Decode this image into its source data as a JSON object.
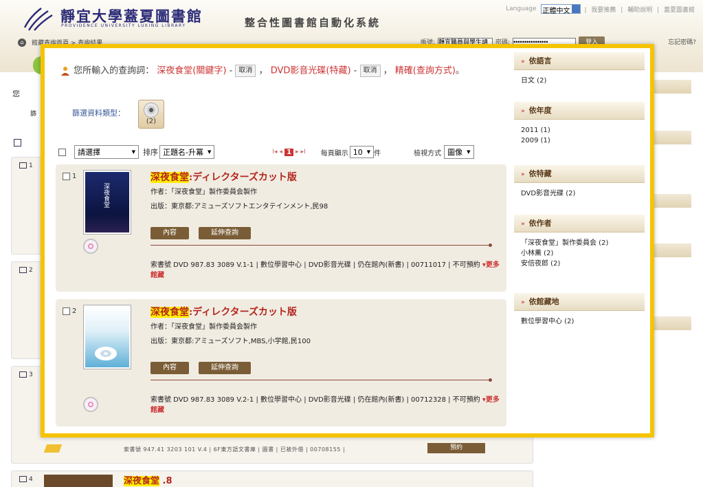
{
  "header": {
    "library_name": "靜宜大學蓋夏圖書館",
    "library_name_en": "PROVIDENCE UNIVERSITY LUKING LIBRARY",
    "system_title": "整合性圖書館自動化系統",
    "language_label": "Language",
    "language_value": "正體中文",
    "top_links": [
      "我要推薦",
      "輔助說明",
      "蓋夏圖書館"
    ],
    "breadcrumb": "館藏查詢首頁 > 查詢結果",
    "account_label": "帳號:",
    "account_placeholder": "靜宜職員與學生請",
    "password_label": "密碼:",
    "password_value": "••••••••••••••••",
    "login_button": "登入",
    "forgot_link": "忘記密碼?"
  },
  "background": {
    "left_text": "您",
    "left_text2": "篩",
    "rows": [
      "1",
      "2",
      "3",
      "4"
    ],
    "bottom_callno": "索書號 947.41 3203 101 V.4 | 6F東方語文書庫 | 圖書 | 已被外借 | 00708155 |",
    "bottom_button": "預約",
    "item4_title_hl": "深夜食堂",
    "item4_title_rest": " .8"
  },
  "modal": {
    "query_prefix": "您所輸入的查詢詞：",
    "query_term1": "深夜食堂(關鍵字)",
    "cancel": "取消",
    "query_term2": "DVD影音光碟(特藏)",
    "query_suffix": "精確(查詢方式)",
    "filter_label": "篩選資料類型：",
    "filter_count": "(2)",
    "toolbar": {
      "select_all": "請選擇",
      "sort_label": "排序",
      "sort_value": "正題名-升冪",
      "page_current": "1",
      "per_page_label": "每頁顯示",
      "per_page_value": "10",
      "per_page_unit": "件",
      "view_label": "檢視方式",
      "view_value": "圖像"
    },
    "records": [
      {
        "num": "1",
        "title_hl": "深夜食堂",
        "title_rest": ":ディレクターズカット版",
        "author": "作者：「深夜食堂」製作委員会製作",
        "publisher": "出版：東京都:アミューズソフトエンタテインメント,民98",
        "btn_content": "內容",
        "btn_extend": "延伸查詢",
        "call": "索書號 DVD 987.83 3089 V.1-1 | 數位學習中心 | DVD影音光碟 | 仍在館內(新書) | 00711017 | 不可預約",
        "more": "更多館藏"
      },
      {
        "num": "2",
        "title_hl": "深夜食堂",
        "title_rest": ":ディレクターズカット版",
        "author": "作者：「深夜食堂」製作委員会製作",
        "publisher": "出版：東京都:アミューズソフト,MBS,小学館,民100",
        "btn_content": "內容",
        "btn_extend": "延伸查詢",
        "call": "索書號 DVD 987.83 3089 V.2-1 | 數位學習中心 | DVD影音光碟 | 仍在館內(新書) | 00712328 | 不可預約",
        "more": "更多館藏"
      }
    ],
    "facets": [
      {
        "title": "依語言",
        "items": [
          "日文 (2)"
        ]
      },
      {
        "title": "依年度",
        "items": [
          "2011 (1)",
          "2009 (1)"
        ]
      },
      {
        "title": "依特藏",
        "items": [
          "DVD影音光碟 (2)"
        ]
      },
      {
        "title": "依作者",
        "items": [
          "「深夜食堂」製作委員会 (2)",
          "小林薫 (2)",
          "安倍夜郎 (2)"
        ]
      },
      {
        "title": "依館藏地",
        "items": [
          "數位學習中心 (2)"
        ]
      }
    ]
  }
}
